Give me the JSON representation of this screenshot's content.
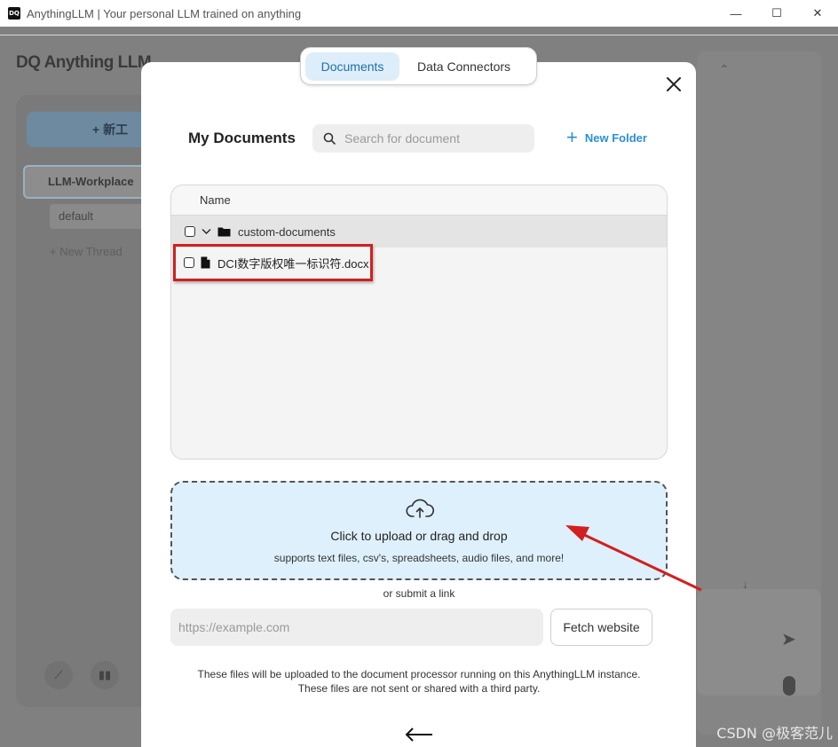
{
  "window": {
    "title": "AnythingLLM | Your personal LLM trained on anything",
    "app_icon_label": "DQ",
    "minimize_glyph": "—",
    "maximize_glyph": "☐",
    "close_glyph": "✕"
  },
  "background": {
    "logo": "DQ Anything LLM",
    "new_workspace_label": "+ 新工",
    "workspace_name": "LLM-Workplace",
    "thread_default": "default",
    "new_thread_label": "+ New Thread",
    "watermark": "CSDN @极客范儿"
  },
  "tabs": [
    {
      "label": "Documents",
      "active": true
    },
    {
      "label": "Data Connectors",
      "active": false
    }
  ],
  "documents": {
    "heading": "My Documents",
    "search_placeholder": "Search for document",
    "new_folder_label": "New Folder",
    "column_name": "Name",
    "folders": [
      {
        "name": "custom-documents",
        "expanded": true,
        "files": [
          {
            "name": "DCI数字版权唯一标识符.docx",
            "highlighted": true
          }
        ]
      }
    ]
  },
  "upload": {
    "title": "Click to upload or drag and drop",
    "subtitle": "supports text files, csv's, spreadsheets, audio files, and more!",
    "or_link": "or submit a link",
    "url_placeholder": "https://example.com",
    "fetch_label": "Fetch website",
    "notice_line1": "These files will be uploaded to the document processor running on this AnythingLLM instance.",
    "notice_line2": "These files are not sent or shared with a third party."
  },
  "colors": {
    "accent": "#2a8fd6",
    "active_tab_bg": "#ddeefa",
    "dropzone_bg": "#def0fc",
    "annotation_red": "#d21f1f"
  }
}
